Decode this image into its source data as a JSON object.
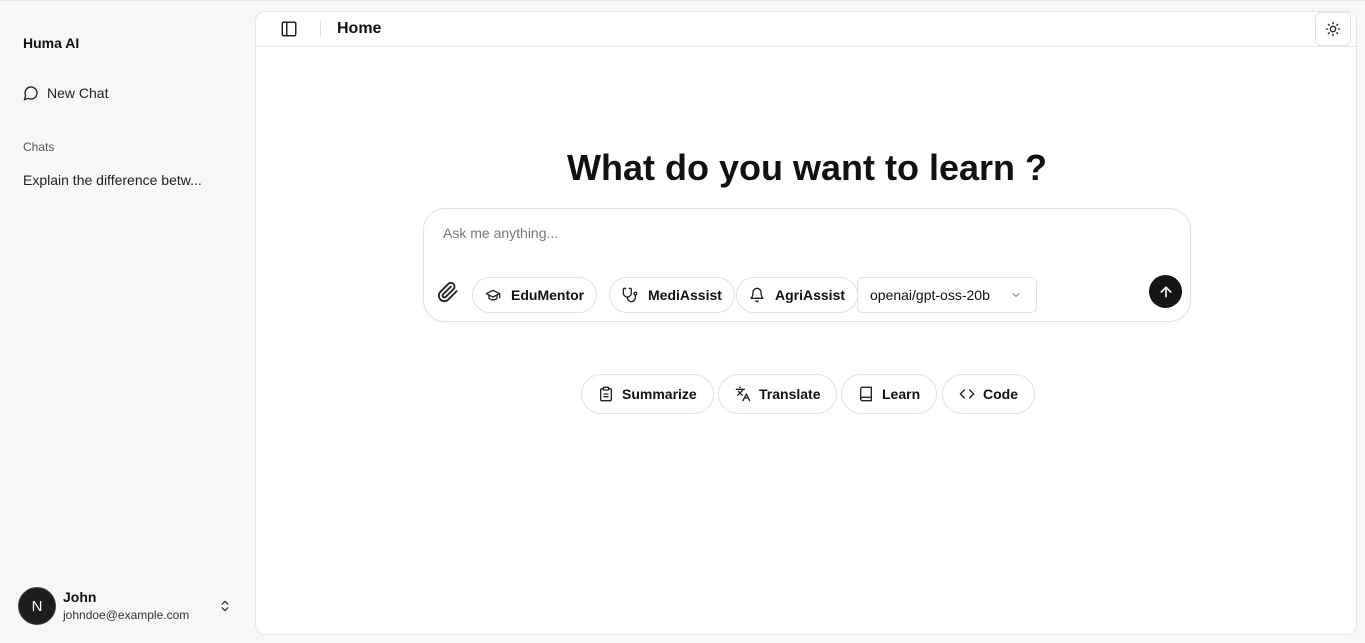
{
  "sidebar": {
    "brand": "Huma AI",
    "new_chat_label": "New Chat",
    "chats_heading": "Chats",
    "chats": [
      {
        "title": "Explain the difference betw..."
      }
    ],
    "user": {
      "avatar_initial": "N",
      "name": "John",
      "email": "johndoe@example.com"
    }
  },
  "header": {
    "title": "Home",
    "theme_icon": "sun-icon",
    "toggle_icon": "sidebar-toggle-icon"
  },
  "main": {
    "hero": "What do you want to learn ?",
    "composer": {
      "placeholder": "Ask me anything...",
      "value": "",
      "assistants": [
        {
          "label": "EduMentor",
          "icon": "graduation-cap-icon"
        },
        {
          "label": "MediAssist",
          "icon": "stethoscope-icon"
        },
        {
          "label": "AgriAssist",
          "icon": "bell-icon"
        }
      ],
      "model": "openai/gpt-oss-20b"
    },
    "quick_actions": [
      {
        "label": "Summarize",
        "icon": "clipboard-icon"
      },
      {
        "label": "Translate",
        "icon": "translate-icon"
      },
      {
        "label": "Learn",
        "icon": "book-icon"
      },
      {
        "label": "Code",
        "icon": "code-icon"
      }
    ]
  },
  "colors": {
    "sidebar_bg": "#f7f7f7",
    "panel_bg": "#ffffff",
    "send_button": "#151515",
    "border": "#e2e2e2"
  }
}
